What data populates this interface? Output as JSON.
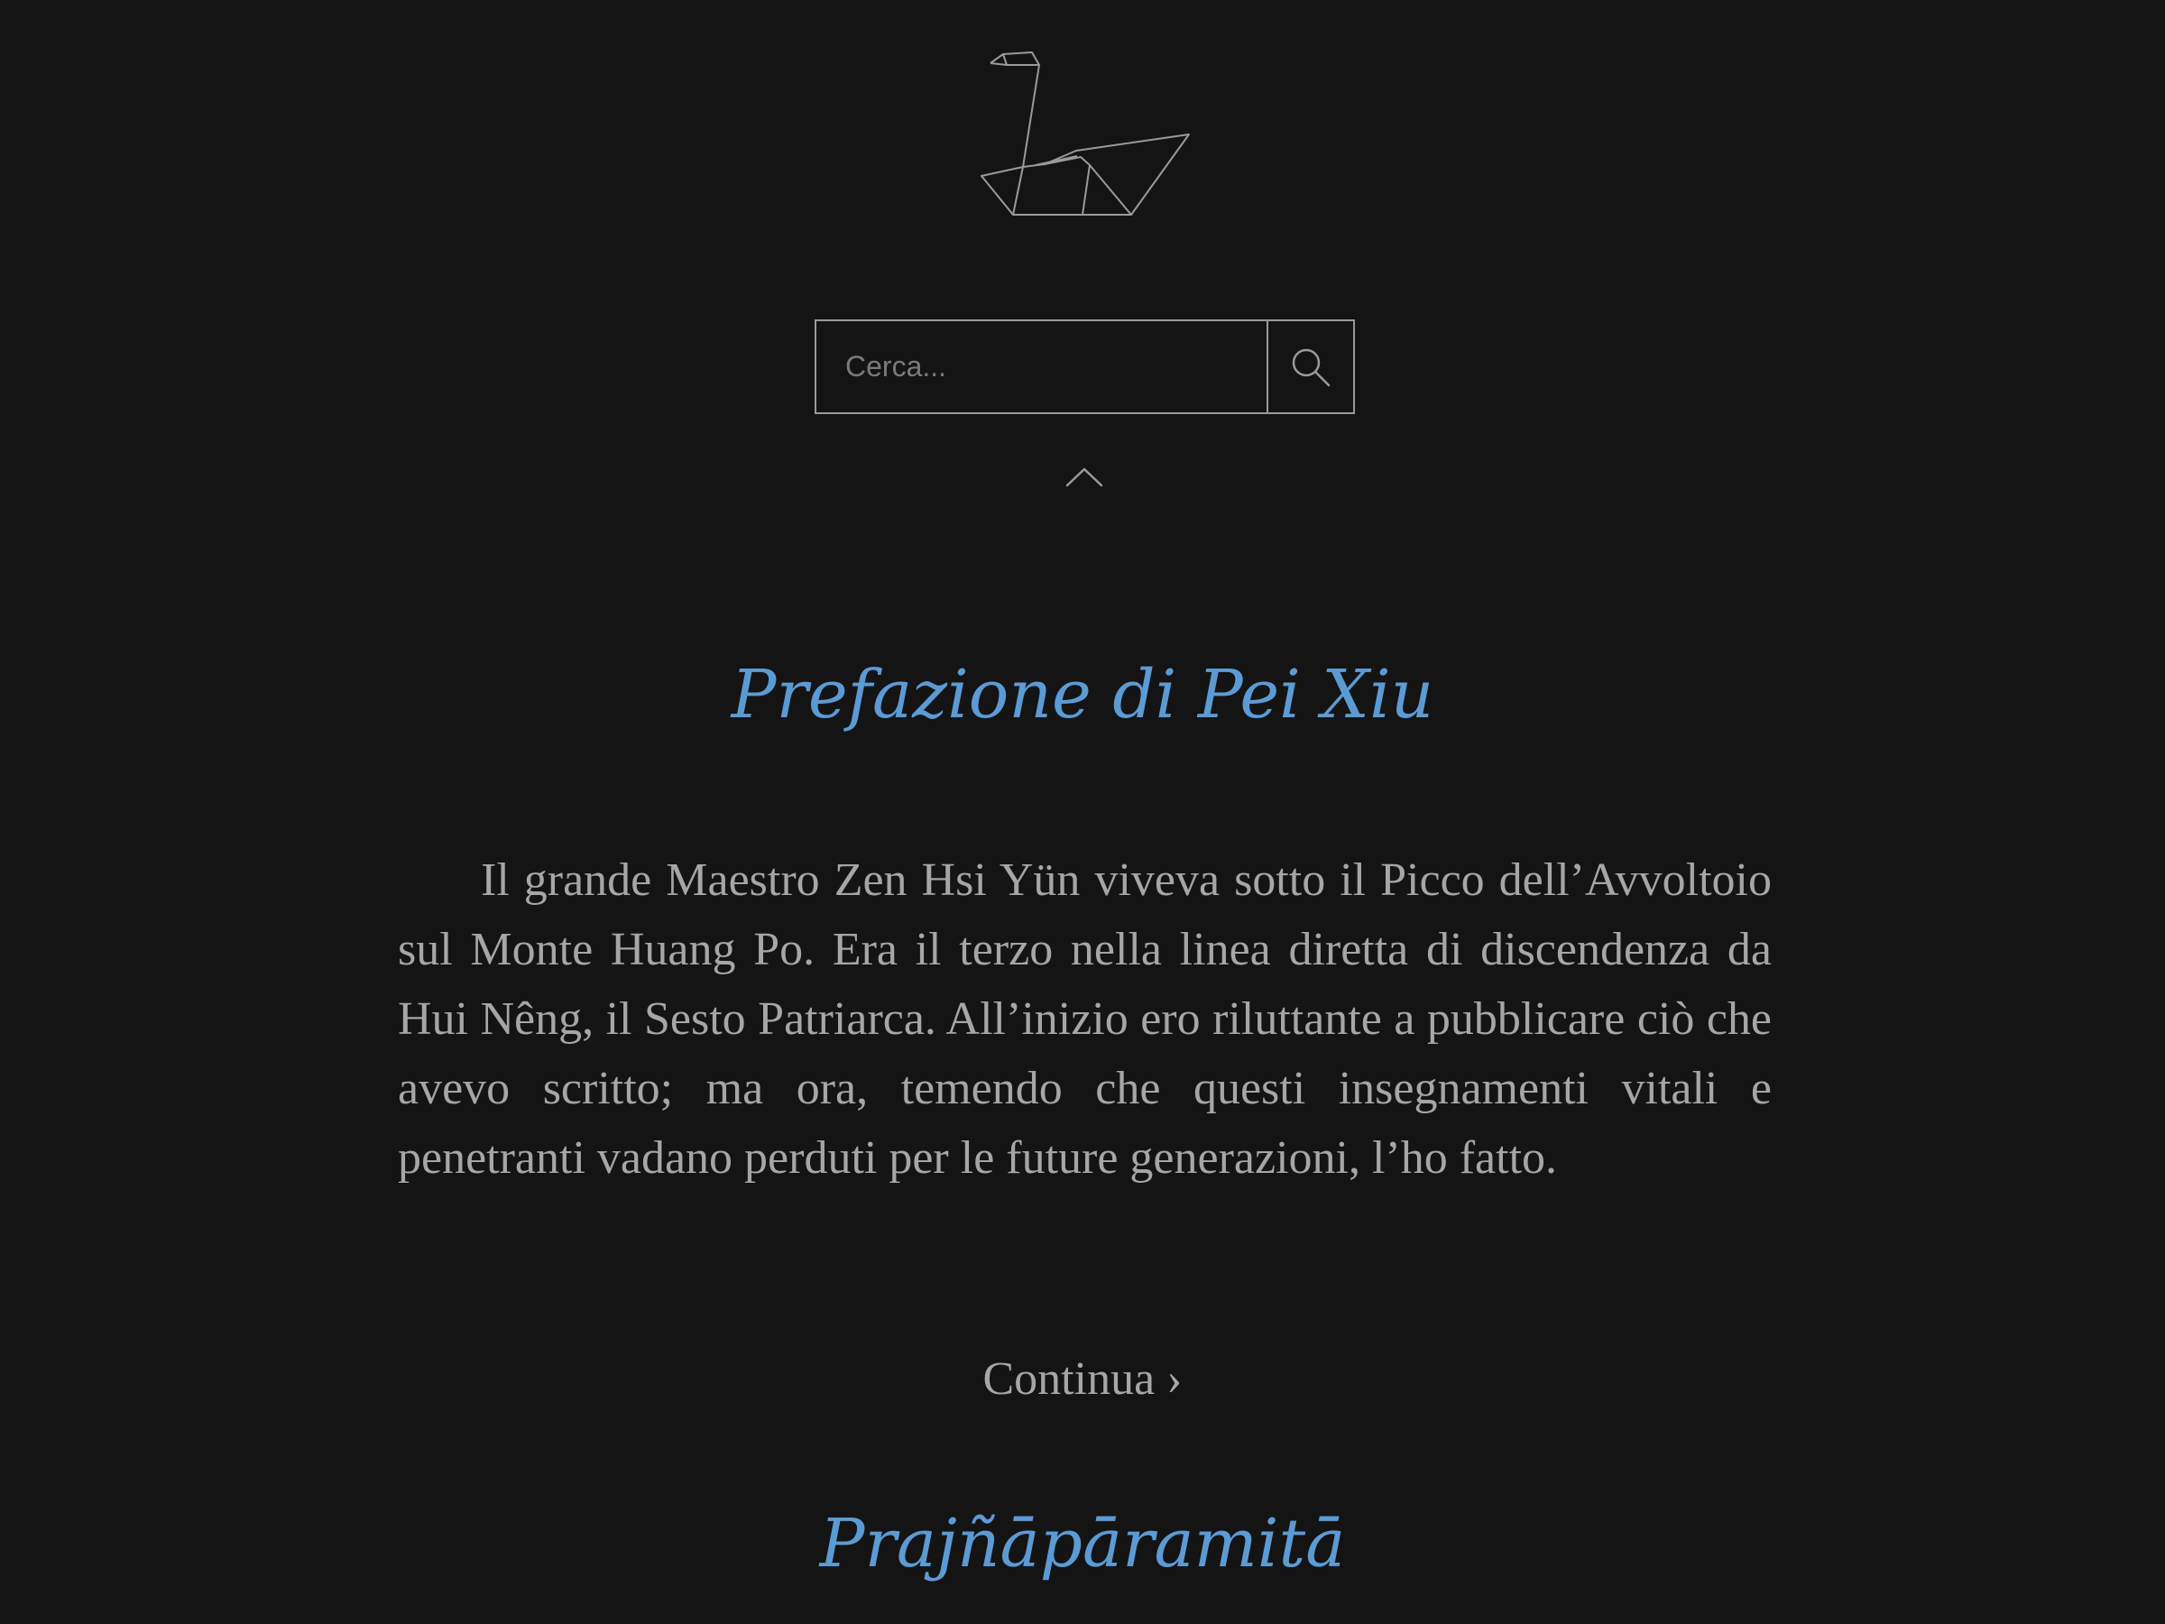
{
  "search": {
    "placeholder": "Cerca...",
    "value": ""
  },
  "icons": {
    "logo": "origami-swan-logo",
    "search": "search-icon",
    "collapse": "chevron-up-icon"
  },
  "colors": {
    "background": "#141414",
    "title": "#5b9bd5",
    "text": "#a6a6a6",
    "border": "#9a9a9a"
  },
  "articles": [
    {
      "title": "Prefazione di Pei Xiu",
      "excerpt": "Il grande Maestro Zen Hsi Yün viveva sotto il Picco dell’Avvoltoio sul Monte Huang Po. Era il terzo nella linea diretta di discendenza da Hui Nêng, il Sesto Patriarca. All’inizio ero riluttante a pubblicare ciò che avevo scritto; ma ora, temendo che questi insegnamenti vitali e penetranti vadano perduti per le future generazioni, l’ho fatto.",
      "continue_label": "Continua ›"
    },
    {
      "title": "Prajñāpāramitā"
    }
  ]
}
